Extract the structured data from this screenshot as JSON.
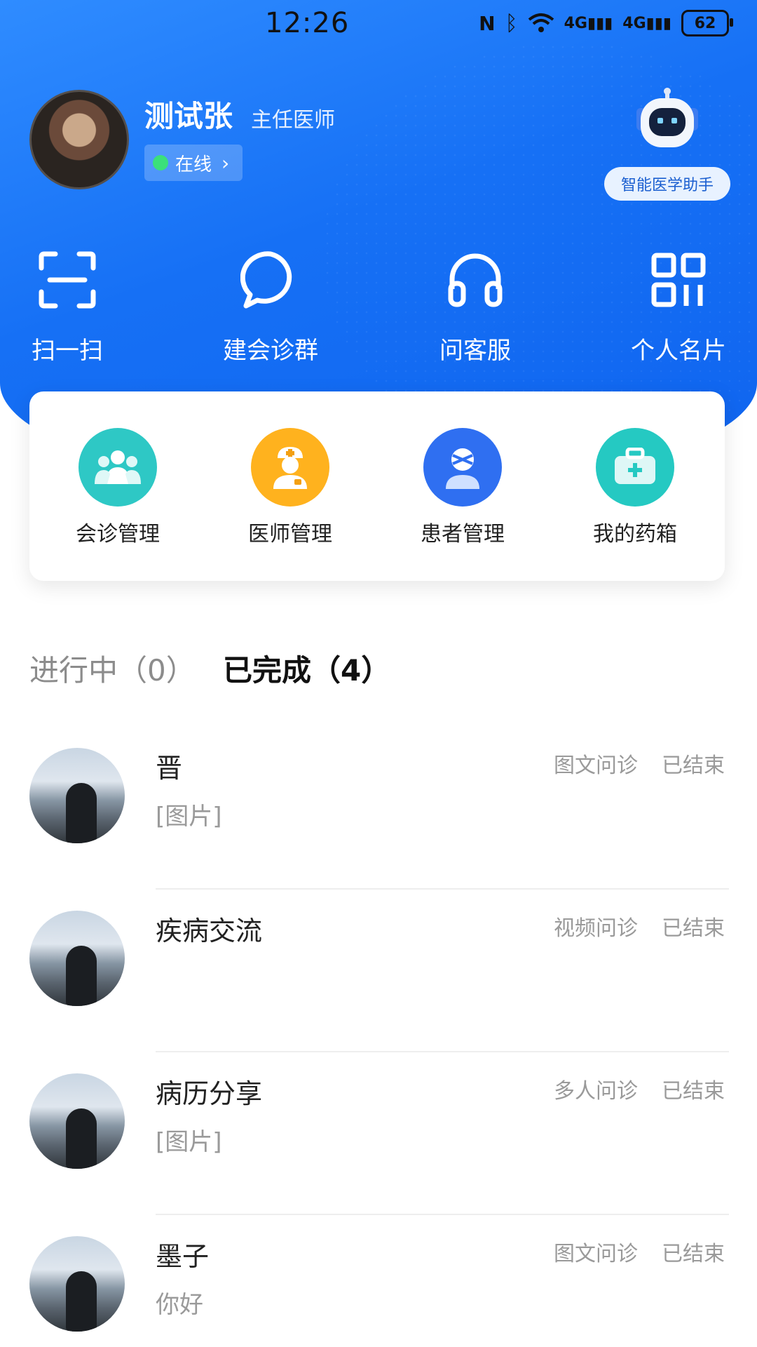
{
  "status_bar": {
    "time": "12:26",
    "network_1": "4G",
    "network_2": "4G",
    "battery": "62"
  },
  "profile": {
    "name": "测试张",
    "title": "主任医师",
    "status": "在线"
  },
  "assistant": {
    "label": "智能医学助手"
  },
  "quick_actions": [
    {
      "label": "扫一扫",
      "icon": "scan-icon"
    },
    {
      "label": "建会诊群",
      "icon": "chat-bubble-icon"
    },
    {
      "label": "问客服",
      "icon": "headset-icon"
    },
    {
      "label": "个人名片",
      "icon": "qr-code-icon"
    }
  ],
  "management": [
    {
      "label": "会诊管理",
      "icon": "group-icon",
      "color": "#2ec8c5"
    },
    {
      "label": "医师管理",
      "icon": "doctor-icon",
      "color": "#ffb21e"
    },
    {
      "label": "患者管理",
      "icon": "patient-icon",
      "color": "#2f6ff1"
    },
    {
      "label": "我的药箱",
      "icon": "medicine-box-icon",
      "color": "#25c9c2"
    }
  ],
  "tabs": {
    "ongoing": "进行中（0）",
    "completed": "已完成（4）"
  },
  "consultations": [
    {
      "name": "晋",
      "preview": "[图片]",
      "type": "图文问诊",
      "status": "已结束"
    },
    {
      "name": "疾病交流",
      "preview": "",
      "type": "视频问诊",
      "status": "已结束"
    },
    {
      "name": "病历分享",
      "preview": "[图片]",
      "type": "多人问诊",
      "status": "已结束"
    },
    {
      "name": "墨子",
      "preview": "你好",
      "type": "图文问诊",
      "status": "已结束"
    }
  ]
}
